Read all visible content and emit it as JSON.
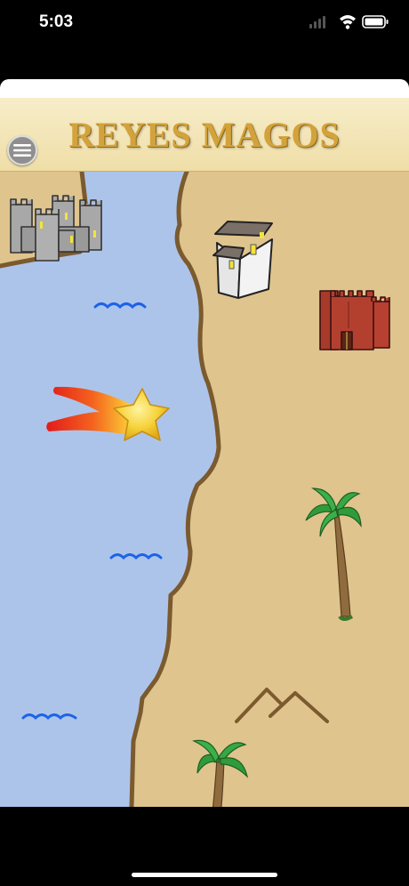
{
  "status_bar": {
    "time": "5:03",
    "icons": [
      "cellular-signal-icon",
      "wifi-icon",
      "battery-icon"
    ]
  },
  "header": {
    "title": "REYES MAGOS",
    "menu_icon": "hamburger-menu-icon"
  },
  "map": {
    "colors": {
      "sea": "#adc4ea",
      "land": "#dfc48e",
      "coast": "#7b5a2e",
      "title_gold": "#d4a23b"
    },
    "items": [
      "castle-gray-icon",
      "house-white-icon",
      "castle-red-icon",
      "shooting-star-icon",
      "wave-icon",
      "palm-tree-icon",
      "mountains-icon"
    ]
  }
}
